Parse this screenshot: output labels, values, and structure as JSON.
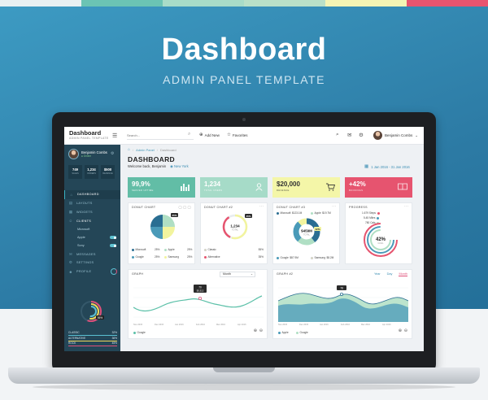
{
  "palette": [
    "#e8f0f2",
    "#6bc4b4",
    "#a8dcc8",
    "#b9e0c8",
    "#f4f4b4",
    "#e8546f"
  ],
  "hero": {
    "title": "Dashboard",
    "subtitle": "ADMIN PANEL TEMPLATE"
  },
  "app": {
    "brand": "Dashboard",
    "brand_sub": "ADMIN PANEL TEMPLATE",
    "search_placeholder": "Search...",
    "add_new": "Add New",
    "favorites": "Favorites",
    "user": "Benjamin Combs"
  },
  "sidebar": {
    "name": "Benjamin Combs",
    "status": "● Online",
    "stats": [
      {
        "value": "749",
        "label": "SALES"
      },
      {
        "value": "1,234",
        "label": "ORDERS"
      },
      {
        "value": "$500",
        "label": "REVENUE"
      }
    ],
    "nav": [
      {
        "label": "DASHBOARD",
        "icon": "⌂",
        "active": true
      },
      {
        "label": "LAYOUTS",
        "icon": "▤"
      },
      {
        "label": "WIDGETS",
        "icon": "▦"
      },
      {
        "label": "CLIENTS",
        "icon": "☺"
      },
      {
        "label": "MESSAGES",
        "icon": "✉"
      },
      {
        "label": "SETTINGS",
        "icon": "⚙"
      },
      {
        "label": "PROFILE",
        "icon": "☻"
      }
    ],
    "clients_sub": [
      {
        "label": "Microsoft"
      },
      {
        "label": "Apple"
      },
      {
        "label": "Sony"
      }
    ],
    "donut_pct": "56%",
    "donut_small": "56%",
    "legend": [
      {
        "label": "CLASSIC",
        "value": "32%",
        "color": "#5bc0d3"
      },
      {
        "label": "ALTERNATIVE",
        "value": "36%",
        "color": "#f0d85a"
      },
      {
        "label": "ROCK",
        "value": "45%",
        "color": "#e0507a"
      }
    ]
  },
  "main": {
    "breadcrumb": {
      "home": "Admin Panel",
      "current": "Dashboard"
    },
    "title": "DASHBOARD",
    "welcome": "Welcome back, Benjamin",
    "location": "New York",
    "daterange": "1 Jan 2016 - 31 Jan 2016",
    "kpis": [
      {
        "value": "99,9%",
        "label": "SERVER UPTIME",
        "color": "#62bda6",
        "icon": "▮▯▮"
      },
      {
        "value": "1,234",
        "label": "TOTAL USERS",
        "color": "#a6dbc8",
        "icon": "♙"
      },
      {
        "value": "$20,000",
        "label": "REVENUE",
        "color": "#f4f6a8",
        "icon": "🛒"
      },
      {
        "value": "+42%",
        "label": "BOOKINGS",
        "color": "#e6546f",
        "icon": "▭"
      }
    ],
    "donut1": {
      "title": "DONUT CHART",
      "badge": "25%",
      "legend": [
        {
          "label": "Microsoft",
          "color": "#2a6e92"
        },
        {
          "label": "Apple",
          "color": "#b0dfc4"
        },
        {
          "label": "Google",
          "color": "#4a9ab8"
        },
        {
          "label": "Samsung",
          "color": "#f2f49e"
        }
      ],
      "values": [
        "25%",
        "25%",
        "25%",
        "25%"
      ]
    },
    "donut2": {
      "title": "DONUT CHART #2",
      "badge": "45%",
      "center": "1,234",
      "center_sub": "TOTAL",
      "legend": [
        {
          "label": "Classic",
          "value": "55%",
          "color": "#f2f49e"
        },
        {
          "label": "Alternative",
          "value": "35%",
          "color": "#e6546f"
        }
      ]
    },
    "donut3": {
      "title": "DONUT CHART #3",
      "badge": "42%",
      "center": "$459M",
      "center_sub": "TOTAL",
      "legend": [
        {
          "label": "Microsoft",
          "value": "$123.1M",
          "color": "#2a6e92"
        },
        {
          "label": "Apple",
          "value": "$19.7M",
          "color": "#b0dfc4"
        },
        {
          "label": "Google",
          "value": "$87.9M",
          "color": "#4a9ab8"
        },
        {
          "label": "Samsung",
          "value": "$8.2M",
          "color": "#f2f49e"
        }
      ]
    },
    "progress": {
      "title": "PROGRESS",
      "items": [
        {
          "label": "1.679 Steps",
          "color": "#e6546f"
        },
        {
          "label": "5.45 Miles",
          "color": "#4a9ab8"
        },
        {
          "label": "780 Cals",
          "color": "#b0dfc4"
        }
      ],
      "center": "42%",
      "center_sub": "GOAL"
    },
    "graph1": {
      "title": "GRAPH",
      "select": "Month",
      "tip_value": "70",
      "tip_sub": "$5,312",
      "legend": "Google",
      "xlabels": [
        "Nov 2015",
        "Dec 2015",
        "Jan 2016",
        "Feb 2016",
        "Mar 2016",
        "Apr 2016",
        "May 2016"
      ]
    },
    "graph2": {
      "title": "GRAPH #2",
      "tabs": [
        "Year",
        "Day",
        "Month"
      ],
      "tip_value": "78",
      "legend": [
        "Apple",
        "Google"
      ],
      "xlabels": [
        "Nov 2015",
        "Dec 2015",
        "Jan 2016",
        "Feb 2016",
        "Mar 2016",
        "Apr 2016",
        "May 2016"
      ]
    }
  }
}
